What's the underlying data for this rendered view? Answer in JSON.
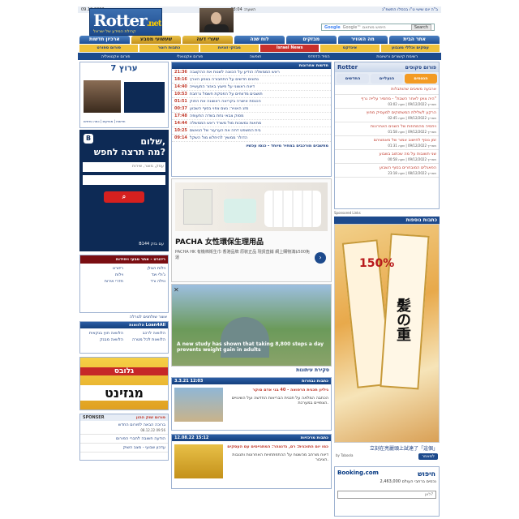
{
  "topbar": {
    "left": "09.12.2022",
    "time_label": "השעה:",
    "time": "03:04",
    "right": "ב\"ה יום שישי ט\"ו בכסלו התשפ\"ג"
  },
  "header": {
    "logo": "Rotter",
    "logo_suffix": ".net",
    "slogan": "קהילת המידע של ישראל",
    "search_brand": "Google",
    "search_placeholder": "Google™ חיפוש מותאם",
    "search_button": "Search"
  },
  "nav": [
    "אתר הבית",
    "מה האוויר",
    "מבזקים",
    "לוח שנה",
    "שערי דעה",
    "שעשועי מטבע",
    "ארכיון חדשות"
  ],
  "nav2": [
    "עסקים וכללי מצבוע",
    "אינדקס",
    "Israel News",
    "מבזקי זוגיות",
    "כתבות רוטר",
    "פורום ספורט"
  ],
  "nav3": [
    "רשימת קישורים ורשיונות",
    "הפיד הדפדפ",
    "חופשה",
    "פורום אקטואלי",
    "פורום אקטואליה"
  ],
  "forum": {
    "title": "פורום סקופים",
    "tabs": [
      "הנצפים",
      "הנעליים",
      "החדשים"
    ],
    "items": [
      {
        "t": "ארבעה משיבים שהותבלות",
        "meta": ""
      },
      {
        "t": "\"היה צוינן לאחר השבת\" - מחמיר עלייה גרף",
        "meta": "מאריך 09/12/2022 | שעה 03:02"
      },
      {
        "t": "הרקע לשלילת המשתוקים למעסיק מחוץ",
        "meta": "מאריך 09/12/2022 | שעה 02:45"
      },
      {
        "t": "ויחסיה מהמחוזות של השנים האחרונות",
        "meta": "מאריך 09/12/2022 | שעה 01:58"
      },
      {
        "t": "זמן נוסף לחישוב אמור של מאמציהם",
        "meta": "מאריך 09/12/2022 | שעה 01:31"
      },
      {
        "t": "שני תשובות על מה שכתוב בשבוע",
        "meta": "מאריך 09/12/2022 | שעה 00:58"
      },
      {
        "t": "הפאנלים המובחרים בסוף השבוע",
        "meta": "מאריך 08/12/2022 | שעה 23:18"
      }
    ]
  },
  "news": {
    "title": "חדשות אחרונות",
    "items": [
      {
        "tm": "21:36",
        "tx": "ראש הממשלה הודיע על הכוונה לשנות את ההקצבה"
      },
      {
        "tm": "18:16",
        "tx": "נתונים חדשים על התחבורה בצפון הארץ"
      },
      {
        "tm": "14:40",
        "tx": "דיווח ראשוני על פיצוץ באזור התעשייה"
      },
      {
        "tm": "10:53",
        "tx": "תושבים מדווחים על הפסקת חשמל נרחבת"
      },
      {
        "tm": "01:51",
        "tx": "הכנסת אישרה בקריאה ראשונה את החוק"
      },
      {
        "tm": "00:37",
        "tx": "מזג האוויר: גשם צפוי בסוף השבוע"
      },
      {
        "tm": "17:48",
        "tx": "מסוק צבאי נחת בשדה התעופה"
      },
      {
        "tm": "14:44",
        "tx": "מחאות נמשכות מול משרד ראש הממשלה"
      },
      {
        "tm": "10:25",
        "tx": "בית המשפט דחה את הערעור של הנאשם"
      },
      {
        "tm": "09:14",
        "tx": "הדולר ממשיך להיחלש מול השקל"
      }
    ],
    "footer": "מחשבים מורכבים במחיר מיוחד - כנסו עכשיו"
  },
  "ad1": {
    "title": "PACHA 女性環保生理用品",
    "sub": "PACHA HK 有機棉衛生巾 香港品牌 原裝正品 現貨直銷 網上購物滿$500免運",
    "sponsored": "Sponsored Links"
  },
  "ad2": {
    "caption": "A new study has shown that taking 8,800 steps a day prevents weight gain in adults",
    "footer": "סקירת עיתונות"
  },
  "articles": [
    {
      "time": "12:03",
      "date": "3.3.21",
      "head": "כתבות נבחרות",
      "title": "גיליון תכנית הרפואה - 40 בני אדם סוקר",
      "body": "הכתבה המלאה על תכנית הבריאות החדשה ועל השינויים הצפויים במערכת."
    },
    {
      "time": "15:12",
      "date": "12.08.22",
      "head": "כתבות מרכזיות",
      "title": "כמו יום התוכנית: רם, גדנצהר: המתגייסים עם העסקים",
      "body": "דיווח מורחב מהשטח על ההתפתחויות האחרונות ותגובות הציבור."
    }
  ],
  "left": {
    "logo": "ערוץ 7",
    "news_caption": "חדשות | מבזקים | כמה טרפים",
    "greeting": "שלום,",
    "question": "מה תרצה לחפש?",
    "search_placeholder": "עסק, מוצר, שירות",
    "footer": "B144 עם בזק",
    "resort_title": "ריזורט - אתר טבעי ויחידות",
    "links": [
      "וילות הגולן",
      "ריזורט",
      "ג'ולי וינד",
      "וילות",
      "ווילה ורד",
      "חדרי אירוח"
    ],
    "brand_box": "אוצר שולחנים לגורלה",
    "loans_title": "הלוואות Loan4All",
    "loan_items": [
      "הלוואה לרכב",
      "הלוואה חוץ בנקאית",
      "הלוואות לכל מטרה",
      "הלוואה מבנק"
    ],
    "magazine_top": "גלובס",
    "magazine": "מגזינט",
    "forum_title": "פורום שוק ההון",
    "sponsor": "SPONSER",
    "forum_items": [
      "ברוכה הבאה לפורום החדש",
      "הודעה חשובה לחברי הפורום",
      "עדכון שבועי - מצב השוק"
    ],
    "forum_meta": "09:56 08.12.22"
  },
  "right_bottom": {
    "banner": "חיפוש חופשה קלה ונוחה - Booking.com",
    "booking": "Booking.com",
    "booking_title": "חיפוש",
    "booking_text": "2,463,000 נכסים ברחבי העולם",
    "booking_input": "לאן? ",
    "sponsored_label": "Sponsored Links",
    "promo_title": "כתבות נוספות",
    "promo_badge": "150%",
    "promo_text": "髪の重",
    "ad_caption": "立刻在亮麗頭上試達了「這個」",
    "ad_by": "by Taboola",
    "ad_more": "למאמר"
  }
}
